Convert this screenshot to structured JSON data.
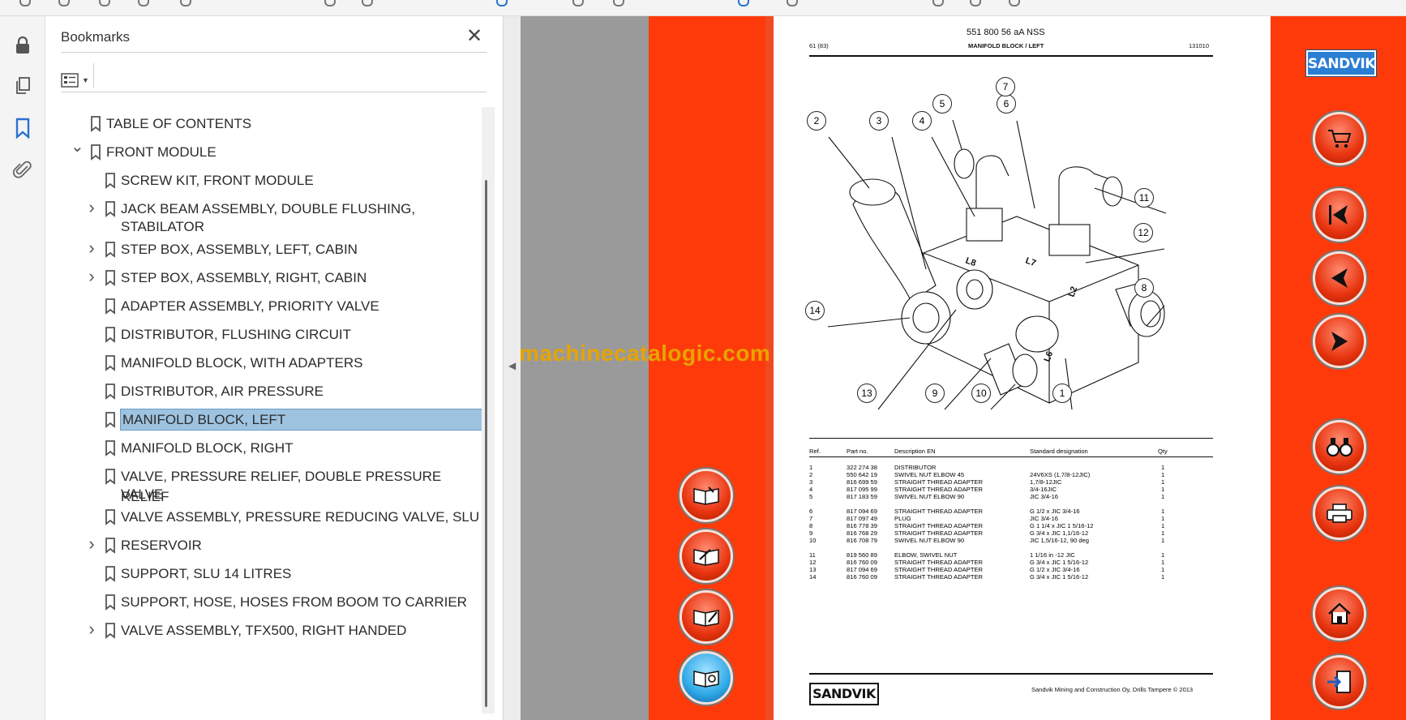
{
  "panel": {
    "title": "Bookmarks",
    "close": "✕"
  },
  "bookmarks": [
    {
      "label": "TABLE OF CONTENTS",
      "level": 0,
      "expander": "none"
    },
    {
      "label": "FRONT MODULE",
      "level": 0,
      "expander": "expanded"
    },
    {
      "label": "SCREW KIT, FRONT MODULE",
      "level": 1,
      "expander": "none"
    },
    {
      "label": "JACK BEAM ASSEMBLY, DOUBLE FLUSHING,",
      "label2": "STABILATOR",
      "level": 1,
      "expander": "collapsed"
    },
    {
      "label": "STEP BOX, ASSEMBLY, LEFT, CABIN",
      "level": 1,
      "expander": "collapsed"
    },
    {
      "label": "STEP BOX, ASSEMBLY, RIGHT, CABIN",
      "level": 1,
      "expander": "collapsed"
    },
    {
      "label": "ADAPTER ASSEMBLY, PRIORITY VALVE",
      "level": 1,
      "expander": "none"
    },
    {
      "label": "DISTRIBUTOR, FLUSHING CIRCUIT",
      "level": 1,
      "expander": "none"
    },
    {
      "label": "MANIFOLD BLOCK, WITH ADAPTERS",
      "level": 1,
      "expander": "none"
    },
    {
      "label": "DISTRIBUTOR, AIR PRESSURE",
      "level": 1,
      "expander": "none"
    },
    {
      "label": "MANIFOLD BLOCK, LEFT",
      "level": 1,
      "expander": "none",
      "selected": true
    },
    {
      "label": "MANIFOLD BLOCK, RIGHT",
      "level": 1,
      "expander": "none"
    },
    {
      "label": "VALVE, PRESSURE RELIEF, DOUBLE PRESSURE RELIEF",
      "label2": "VALVE",
      "level": 1,
      "expander": "none"
    },
    {
      "label": "VALVE ASSEMBLY, PRESSURE REDUCING VALVE, SLU",
      "level": 1,
      "expander": "none"
    },
    {
      "label": "RESERVOIR",
      "level": 1,
      "expander": "collapsed"
    },
    {
      "label": "SUPPORT, SLU 14 LITRES",
      "level": 1,
      "expander": "none"
    },
    {
      "label": "SUPPORT, HOSE, HOSES FROM BOOM TO CARRIER",
      "level": 1,
      "expander": "none"
    },
    {
      "label": "VALVE ASSEMBLY, TFX500, RIGHT HANDED",
      "level": 1,
      "expander": "collapsed"
    }
  ],
  "document": {
    "doc_number": "551 800 56 aA NSS",
    "page_ref": "61 (83)",
    "section_title": "MANIFOLD BLOCK / LEFT",
    "date_code": "131010",
    "watermark": "machinecatalogic.com",
    "brand": "SANDVIK",
    "footer_text": "Sandvik Mining and Construction Oy, Drills Tampere © 2013",
    "table_headers": {
      "ref": "Ref.",
      "part": "Part no.",
      "desc": "Description EN",
      "std": "Standard designation",
      "qty": "Qty"
    },
    "parts": [
      {
        "ref": "1",
        "part": "322 274 38",
        "desc": "DISTRIBUTOR",
        "std": "",
        "qty": "1"
      },
      {
        "ref": "2",
        "part": "550 642 19",
        "desc": "SWIVEL NUT ELBOW 45",
        "std": "24V6XS (1,7/8-12JIC)",
        "qty": "1"
      },
      {
        "ref": "3",
        "part": "816 699 59",
        "desc": "STRAIGHT THREAD ADAPTER",
        "std": "1,7/8-12JIC",
        "qty": "1"
      },
      {
        "ref": "4",
        "part": "817 095 99",
        "desc": "STRAIGHT THREAD ADAPTER",
        "std": "3/4-16JIC",
        "qty": "1"
      },
      {
        "ref": "5",
        "part": "817 183 59",
        "desc": "SWIVEL NUT ELBOW 90",
        "std": "JIC 3/4-16",
        "qty": "1"
      },
      {
        "ref": "6",
        "part": "817 094 69",
        "desc": "STRAIGHT THREAD ADAPTER",
        "std": "G 1/2 x JIC 3/4-16",
        "qty": "1"
      },
      {
        "ref": "7",
        "part": "817 097 49",
        "desc": "PLUG",
        "std": "JIC 3/4-16",
        "qty": "1"
      },
      {
        "ref": "8",
        "part": "816 778 39",
        "desc": "STRAIGHT THREAD ADAPTER",
        "std": "G 1 1/4 x JIC 1 5/16-12",
        "qty": "1"
      },
      {
        "ref": "9",
        "part": "816 768 29",
        "desc": "STRAIGHT THREAD ADAPTER",
        "std": "G 3/4 x JIC 1,1/16-12",
        "qty": "1"
      },
      {
        "ref": "10",
        "part": "816 708 79",
        "desc": "SWIVEL NUT ELBOW 90",
        "std": "JIC 1,5/16-12, 90 deg",
        "qty": "1"
      },
      {
        "ref": "11",
        "part": "819 560 89",
        "desc": "ELBOW, SWIVEL NUT",
        "std": "1 1/16 in -12 JIC",
        "qty": "1"
      },
      {
        "ref": "12",
        "part": "816 760 09",
        "desc": "STRAIGHT THREAD ADAPTER",
        "std": "G 3/4 x JIC 1 5/16-12",
        "qty": "1"
      },
      {
        "ref": "13",
        "part": "817 094 69",
        "desc": "STRAIGHT THREAD ADAPTER",
        "std": "G 1/2 x JIC 3/4-16",
        "qty": "1"
      },
      {
        "ref": "14",
        "part": "816 760 09",
        "desc": "STRAIGHT THREAD ADAPTER",
        "std": "G 3/4 x JIC 1 5/16-12",
        "qty": "1"
      }
    ],
    "callouts": [
      "1",
      "2",
      "3",
      "4",
      "5",
      "6",
      "7",
      "8",
      "9",
      "10",
      "11",
      "12",
      "13",
      "14"
    ],
    "port_marks": [
      "L8",
      "L7",
      "L2",
      "L6"
    ]
  },
  "left_nav_buttons": [
    "book-open-icon",
    "edit-book-icon",
    "pen-book-icon",
    "book-search-icon"
  ],
  "right_nav_buttons": [
    "cart-icon",
    "first-page-icon",
    "previous-page-icon",
    "next-page-icon",
    "binoculars-icon",
    "printer-icon",
    "home-icon",
    "exit-icon"
  ],
  "colors": {
    "orange": "#ff3a0a",
    "selection": "#9ec3e0",
    "accent": "#2a72d0",
    "watermark": "#e6a400"
  }
}
